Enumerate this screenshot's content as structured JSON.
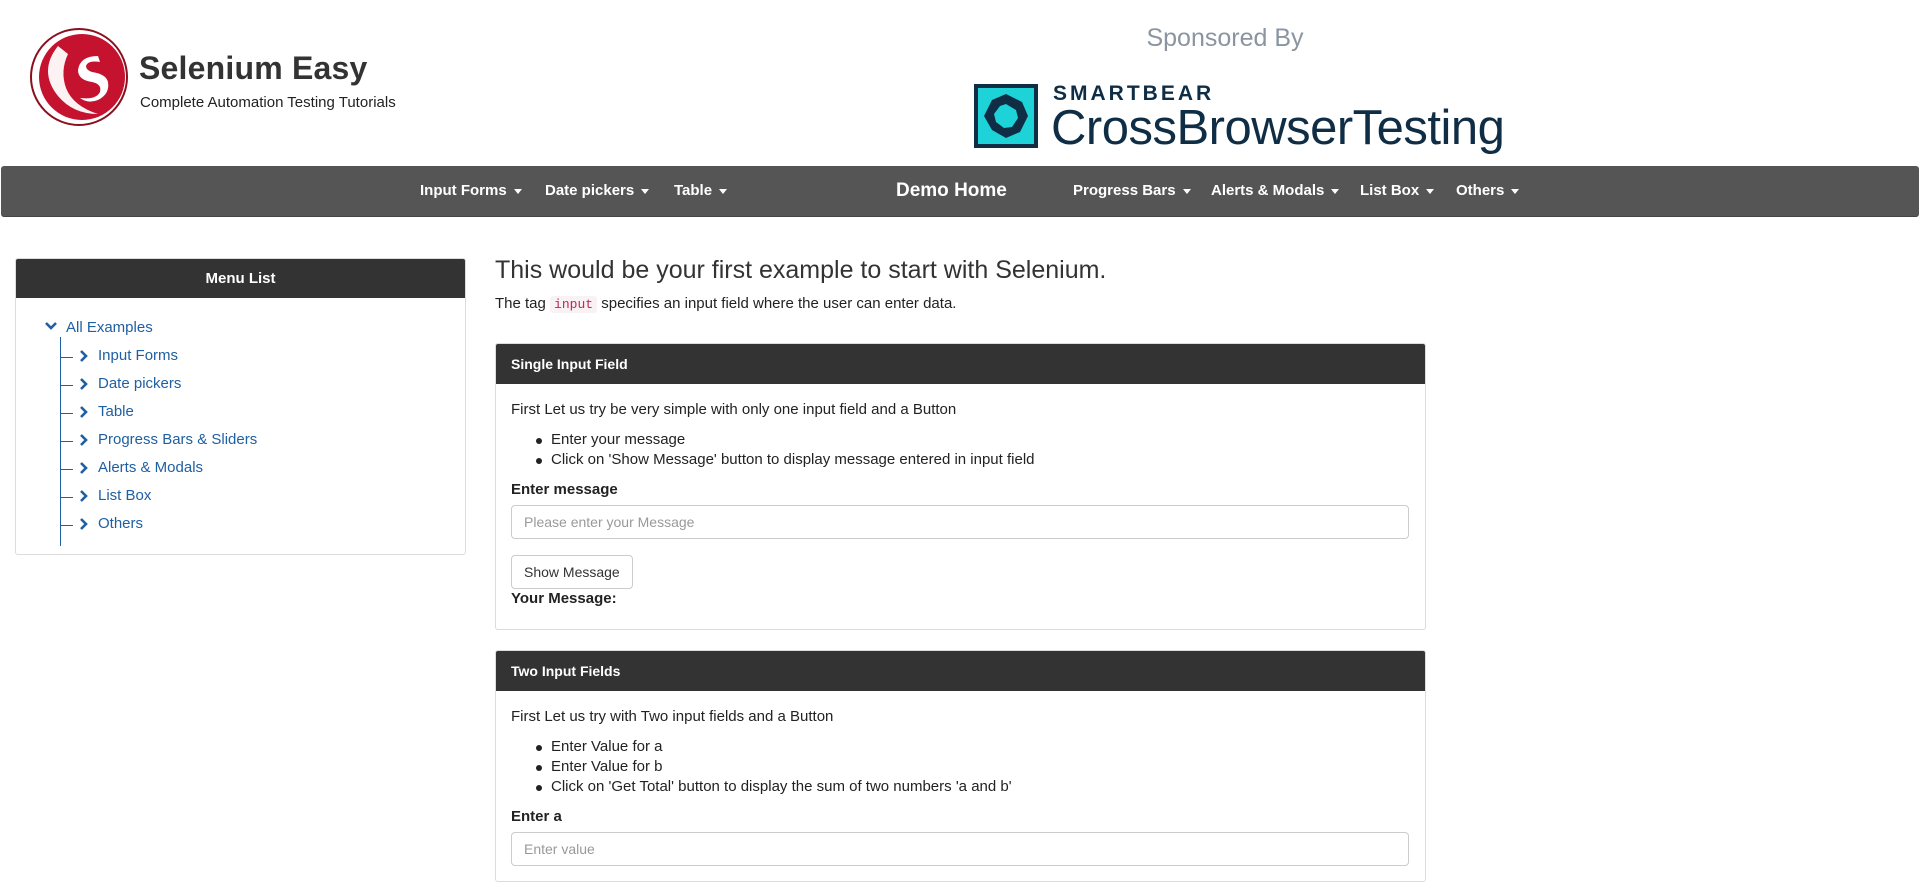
{
  "header": {
    "brand_title": "Selenium Easy",
    "brand_subtitle": "Complete Automation Testing Tutorials",
    "sponsored_by": "Sponsored By",
    "sponsor_company": "SMARTBEAR",
    "sponsor_product": "CrossBrowserTesting",
    "logo_icon": "selenium-easy-logo",
    "sponsor_icon": "smartbear-logo"
  },
  "nav": {
    "items": [
      {
        "label": "Input Forms"
      },
      {
        "label": "Date pickers"
      },
      {
        "label": "Table"
      },
      {
        "label": "Demo Home"
      },
      {
        "label": "Progress Bars"
      },
      {
        "label": "Alerts & Modals"
      },
      {
        "label": "List Box"
      },
      {
        "label": "Others"
      }
    ]
  },
  "sidebar": {
    "title": "Menu List",
    "root": "All Examples",
    "items": [
      {
        "label": "Input Forms"
      },
      {
        "label": "Date pickers"
      },
      {
        "label": "Table"
      },
      {
        "label": "Progress Bars & Sliders"
      },
      {
        "label": "Alerts & Modals"
      },
      {
        "label": "List Box"
      },
      {
        "label": "Others"
      }
    ]
  },
  "main": {
    "title": "This would be your first example to start with Selenium.",
    "desc_prefix": "The tag",
    "desc_code": "input",
    "desc_suffix": "specifies an input field where the user can enter data."
  },
  "single_input": {
    "heading": "Single Input Field",
    "intro": "First Let us try be very simple with only one input field and a Button",
    "steps": [
      "Enter your message",
      "Click on 'Show Message' button to display message entered in input field"
    ],
    "field_label": "Enter message",
    "placeholder": "Please enter your Message",
    "button_label": "Show Message",
    "result_label": "Your Message:"
  },
  "two_inputs": {
    "heading": "Two Input Fields",
    "intro": "First Let us try with Two input fields and a Button",
    "steps": [
      "Enter Value for a",
      "Enter Value for b",
      "Click on 'Get Total' button to display the sum of two numbers 'a and b'"
    ],
    "field_a_label": "Enter a",
    "field_a_placeholder": "Enter value"
  },
  "colors": {
    "navbar": "#555555",
    "panel_header": "#333333",
    "link": "#1f5fa3",
    "logo_red": "#c4122f",
    "sponsor_teal": "#1ed3d8",
    "sponsor_navy": "#0f2d45"
  }
}
